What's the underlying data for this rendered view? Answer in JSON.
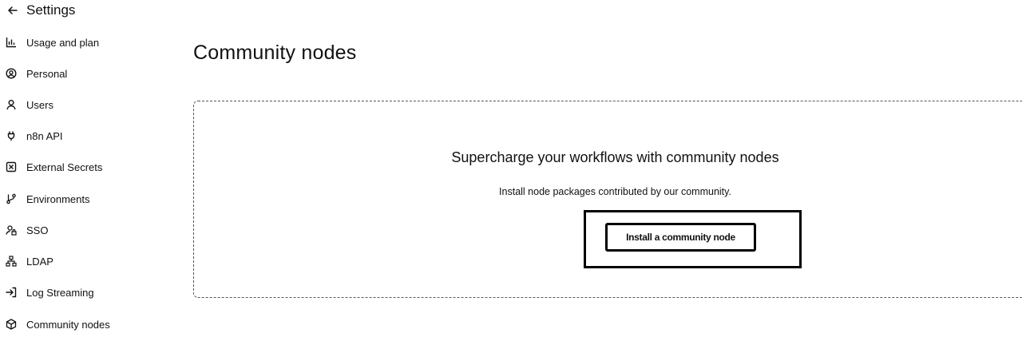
{
  "header": {
    "title": "Settings"
  },
  "sidebar": {
    "items": [
      {
        "label": "Usage and plan"
      },
      {
        "label": "Personal"
      },
      {
        "label": "Users"
      },
      {
        "label": "n8n API"
      },
      {
        "label": "External Secrets"
      },
      {
        "label": "Environments"
      },
      {
        "label": "SSO"
      },
      {
        "label": "LDAP"
      },
      {
        "label": "Log Streaming"
      },
      {
        "label": "Community nodes"
      }
    ]
  },
  "main": {
    "title": "Community nodes",
    "empty_state": {
      "heading": "Supercharge your workflows with community nodes",
      "description": "Install node packages contributed by our community.",
      "button_label": "Install a community node"
    }
  }
}
